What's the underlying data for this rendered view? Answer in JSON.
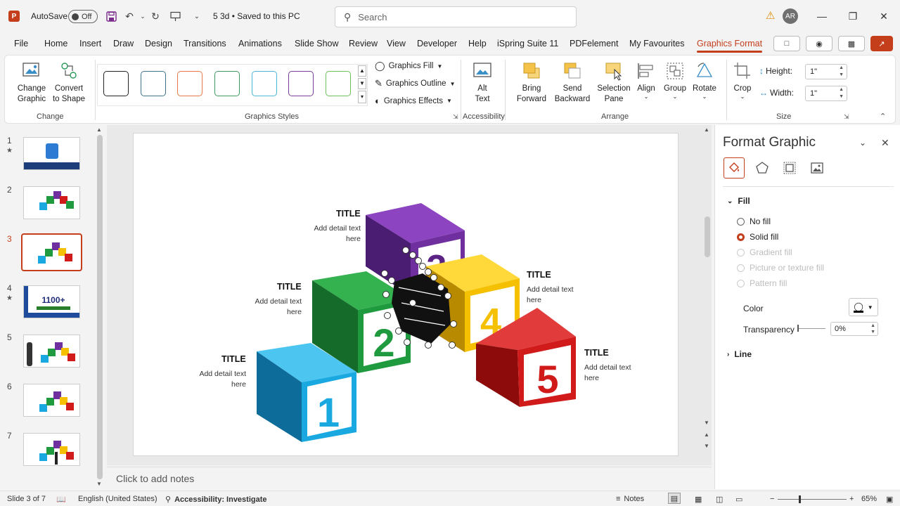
{
  "titlebar": {
    "app_icon": "powerpoint-icon",
    "autosave_label": "AutoSave",
    "autosave_state": "Off",
    "doc_title": "5 3d • Saved to this PC",
    "search_placeholder": "Search",
    "user_initials": "AR",
    "window_buttons": [
      "minimize-icon",
      "restore-icon",
      "close-icon"
    ]
  },
  "menu": {
    "tabs": [
      "File",
      "Home",
      "Insert",
      "Draw",
      "Design",
      "Transitions",
      "Animations",
      "Slide Show",
      "Review",
      "View",
      "Developer",
      "Help",
      "iSpring Suite 11",
      "PDFelement",
      "My Favourites",
      "Graphics Format"
    ],
    "active_tab": "Graphics Format"
  },
  "ribbon": {
    "change_group": {
      "label": "Change",
      "change_graphic": "Change Graphic",
      "convert_to_shape": "Convert to Shape"
    },
    "graphics_styles": {
      "label": "Graphics Styles",
      "swatch_colors": [
        "#222222",
        "#41748c",
        "#e8774a",
        "#3e9a5f",
        "#4eb7d6",
        "#7a3d9a",
        "#6fbf5a"
      ]
    },
    "fill_group": {
      "fill": "Graphics Fill",
      "outline": "Graphics Outline",
      "effects": "Graphics Effects"
    },
    "accessibility": {
      "label": "Accessibility",
      "alt_text": "Alt Text"
    },
    "arrange": {
      "label": "Arrange",
      "bring_forward": "Bring Forward",
      "send_backward": "Send Backward",
      "selection_pane": "Selection Pane",
      "align": "Align",
      "group": "Group",
      "rotate": "Rotate"
    },
    "size": {
      "label": "Size",
      "crop": "Crop",
      "height_label": "Height:",
      "height_value": "1\"",
      "width_label": "Width:",
      "width_value": "1\""
    }
  },
  "thumbnails": {
    "numbers": [
      "1",
      "2",
      "3",
      "4",
      "5",
      "6",
      "7"
    ],
    "active": "3",
    "thumb4_text": "1100+"
  },
  "slide": {
    "captions": [
      {
        "title": "TITLE",
        "text_line1": "Add detail text",
        "text_line2": "here"
      },
      {
        "title": "TITLE",
        "text_line1": "Add detail text",
        "text_line2": "here"
      },
      {
        "title": "TITLE",
        "text_line1": "Add detail text",
        "text_line2": "here"
      },
      {
        "title": "TITLE",
        "text_line1": "Add detail text",
        "text_line2": "here"
      },
      {
        "title": "TITLE",
        "text_line1": "Add detail text",
        "text_line2": "here"
      }
    ],
    "cube_numbers": [
      "1",
      "2",
      "3",
      "4",
      "5"
    ],
    "cube_colors": {
      "blue": "#1aa8e0",
      "green": "#1f9a3e",
      "purple": "#6f2f9e",
      "yellow": "#f5c000",
      "red": "#d11a1a"
    },
    "notes_placeholder": "Click to add notes"
  },
  "format_pane": {
    "title": "Format Graphic",
    "tabs": [
      "fill-bucket-icon",
      "pentagon-icon",
      "size-layout-icon",
      "picture-icon"
    ],
    "fill_section": "Fill",
    "fill_options": [
      "No fill",
      "Solid fill",
      "Gradient fill",
      "Picture or texture fill",
      "Pattern fill"
    ],
    "selected_fill": "Solid fill",
    "color_label": "Color",
    "transparency_label": "Transparency",
    "transparency_value": "0%",
    "line_section": "Line"
  },
  "statusbar": {
    "slide_info": "Slide 3 of 7",
    "language": "English (United States)",
    "accessibility": "Accessibility: Investigate",
    "notes": "Notes",
    "zoom": "65%"
  }
}
